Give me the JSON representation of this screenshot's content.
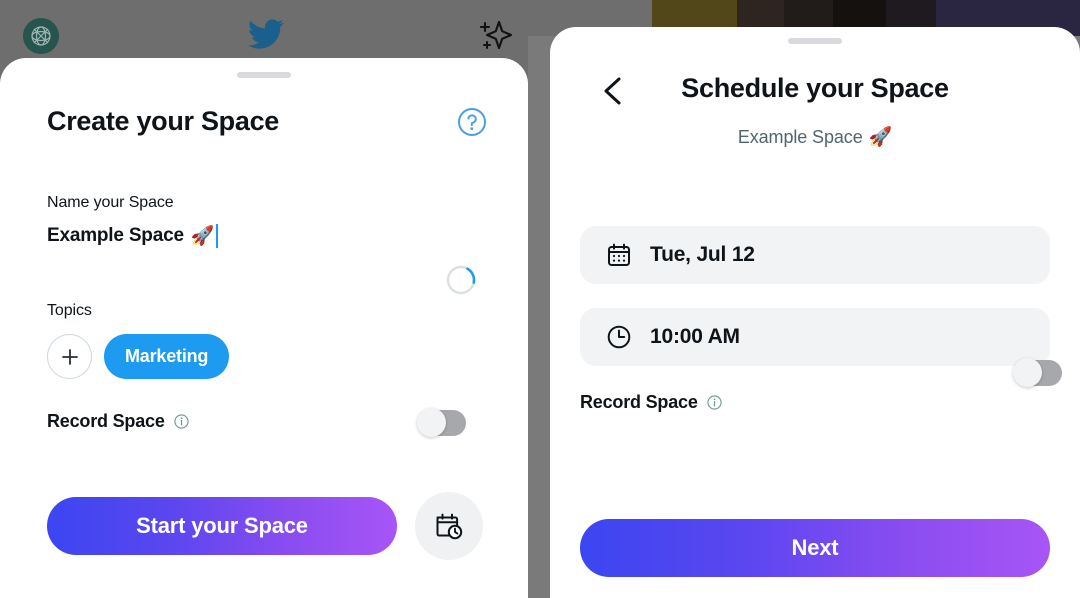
{
  "app": {
    "backdrop": {
      "avatar": "profile-avatar",
      "bird_icon": "twitter-bird-icon",
      "sparkle_icon": "sparkle-icon",
      "strip_colors": [
        "#6e6e6e",
        "#514718",
        "#2e2420",
        "#211c1a",
        "#15110f",
        "#1e1a20",
        "#2a2540"
      ]
    }
  },
  "left_panel": {
    "title": "Create your Space",
    "help_icon": "help-circle-icon",
    "drag_handle": "drag-handle",
    "name_field": {
      "label": "Name your Space",
      "value": "Example Space",
      "emoji": "🚀",
      "char_ring_percent": 20
    },
    "topics": {
      "label": "Topics",
      "add_label": "+",
      "chips": [
        "Marketing"
      ]
    },
    "record": {
      "label": "Record Space",
      "info_icon": "info-icon",
      "toggle_state": "off"
    },
    "primary_button": "Start your Space",
    "schedule_button_icon": "calendar-clock-icon"
  },
  "right_panel": {
    "back_icon": "chevron-left-icon",
    "title": "Schedule your Space",
    "subtitle": "Example Space",
    "subtitle_emoji": "🚀",
    "drag_handle": "drag-handle",
    "rows": [
      {
        "icon": "calendar-icon",
        "value": "Tue, Jul 12"
      },
      {
        "icon": "clock-icon",
        "value": "10:00 AM"
      }
    ],
    "record": {
      "label": "Record Space",
      "info_icon": "info-icon",
      "toggle_state": "off"
    },
    "primary_button": "Next"
  },
  "colors": {
    "twitter_blue": "#1d9bf0",
    "gradient_start": "#3b46f1",
    "gradient_end": "#a855f7",
    "text_primary": "#0f1419",
    "text_secondary": "#536471",
    "pill_bg": "#f1f3f4"
  }
}
